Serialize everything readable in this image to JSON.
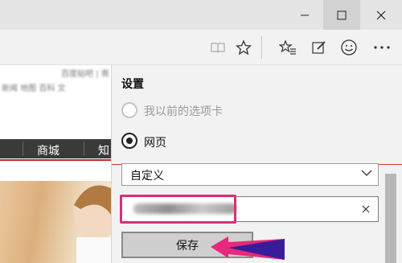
{
  "settings": {
    "title": "设置",
    "radio_prev_tabs_label": "我以前的选项卡",
    "radio_webpage_label": "网页",
    "select_value": "自定义",
    "save_label": "保存"
  },
  "background_page": {
    "nav_items": [
      "商城",
      "知"
    ],
    "blurred_lines": [
      "百度贴吧 | 南",
      "新闻 地图 百科 文"
    ]
  },
  "colors": {
    "highlight": "#d62f7a",
    "accent_red": "#c62828",
    "arrow": "#e8287a"
  },
  "icons": {
    "reading_view": "book-icon",
    "favorite": "star-icon",
    "hub": "star-list-icon",
    "web_note": "pen-note-icon",
    "feedback": "smiley-icon",
    "more": "ellipsis-icon"
  }
}
